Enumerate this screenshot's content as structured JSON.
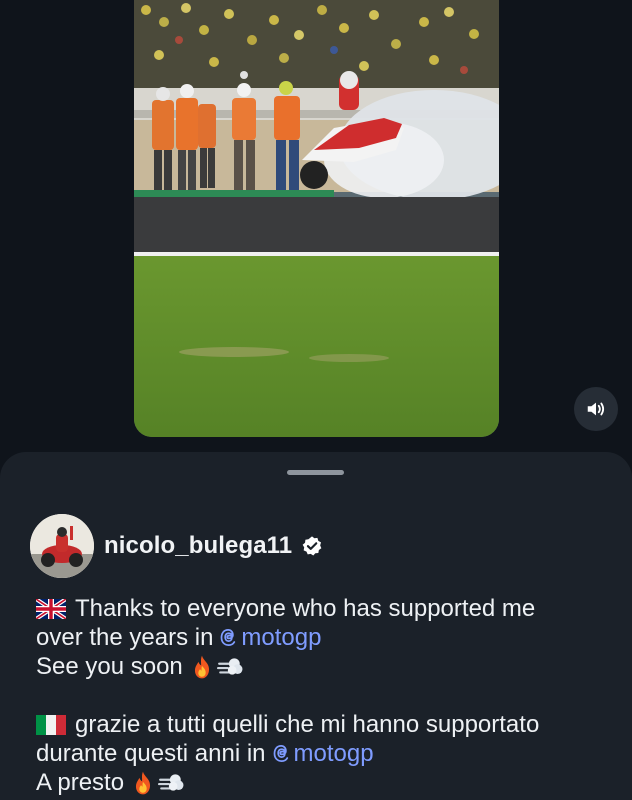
{
  "post": {
    "username": "nicolo_bulega11",
    "verified": true,
    "caption": {
      "en_line1": "Thanks to everyone who has supported me",
      "en_line2_text": "over the years in",
      "en_mention": "motogp",
      "en_line3": "See you soon",
      "it_line1": "grazie a tutti quelli che mi hanno supportato",
      "it_line2_text": "durante questi anni in",
      "it_mention": "motogp",
      "it_line3": "A presto"
    }
  },
  "icons": {
    "volume": "speaker-volume-icon",
    "verified": "verified-badge-icon",
    "mention": "threads-at-icon",
    "flags": [
      "uk-flag-icon",
      "italy-flag-icon"
    ],
    "emojis": [
      "fire-emoji",
      "dash-emoji"
    ]
  },
  "colors": {
    "background": "#0f141b",
    "sheet": "#1b2129",
    "mention": "#7f9cff",
    "text": "#eef1f4"
  }
}
